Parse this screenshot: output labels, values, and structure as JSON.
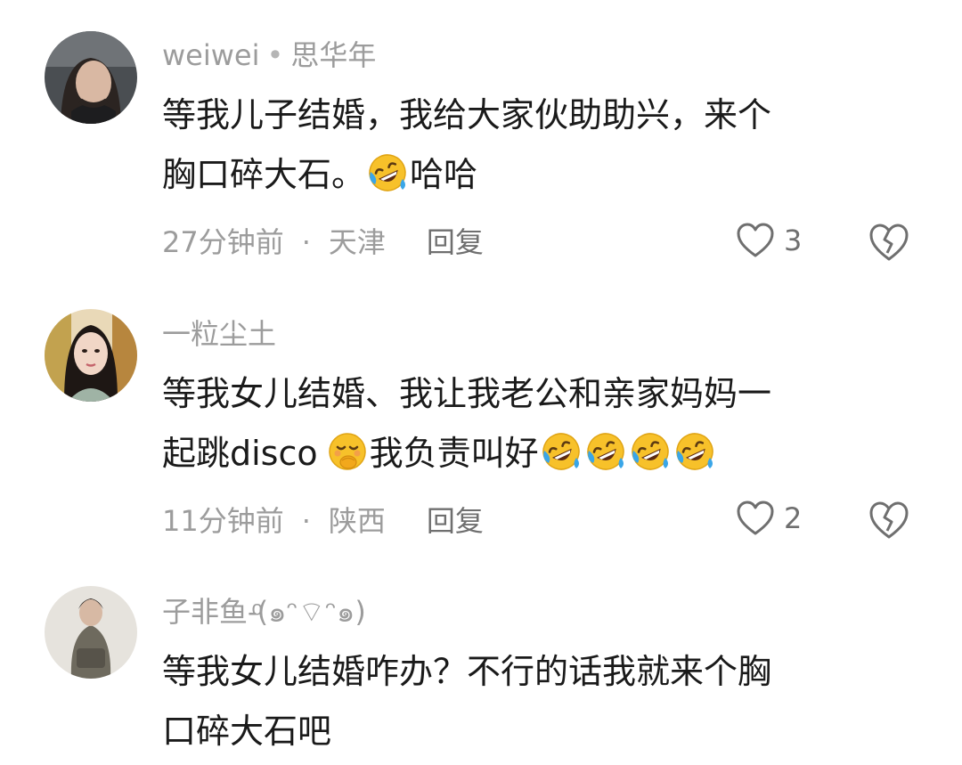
{
  "comments": [
    {
      "author": "weiwei",
      "author_tag": "思华年",
      "line1": "等我儿子结婚，我给大家伙助助兴，来个",
      "line2_text": "胸口碎大石。",
      "line2_tail": "哈哈",
      "line2_emojis": [
        "rofl-emoji"
      ],
      "time": "27分钟前",
      "location": "天津",
      "reply": "回复",
      "likes": "3"
    },
    {
      "author": "一粒尘土",
      "line1": "等我女儿结婚、我让我老公和亲家妈妈一",
      "line2_text": "起跳disco",
      "line2_mid": "我负责叫好",
      "line2_emojis": [
        "giggle-emoji",
        "rofl-emoji",
        "rofl-emoji",
        "rofl-emoji",
        "rofl-emoji"
      ],
      "time": "11分钟前",
      "location": "陕西",
      "reply": "回复",
      "likes": "2"
    },
    {
      "author": "子非鱼-ͦ(๑ᵔ⌔ᵔ๑)",
      "line1": "等我女儿结婚咋办？不行的话我就来个胸",
      "line2_text": "口碎大石吧"
    }
  ],
  "icons": {
    "like": "heart-outline-icon",
    "dislike": "broken-heart-icon"
  }
}
